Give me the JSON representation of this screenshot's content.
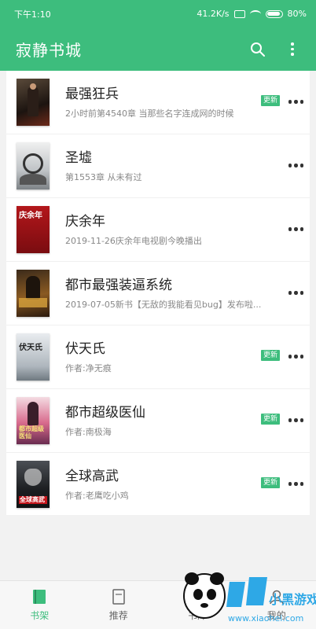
{
  "status": {
    "time": "下午1:10",
    "speed": "41.2K/s",
    "battery": "80%"
  },
  "app": {
    "title": "寂静书城"
  },
  "books": [
    {
      "title": "最强狂兵",
      "subtitle": "2小时前第4540章 当那些名字连成网的时候",
      "updated": true,
      "cover_text": ""
    },
    {
      "title": "圣墟",
      "subtitle": "第1553章 从未有过",
      "updated": false,
      "cover_text": ""
    },
    {
      "title": "庆余年",
      "subtitle": "2019-11-26庆余年电视剧今晚播出",
      "updated": false,
      "cover_text": "庆余年"
    },
    {
      "title": "都市最强装逼系统",
      "subtitle": "2019-07-05新书【无敌的我能看见bug】发布啦...",
      "updated": false,
      "cover_text": ""
    },
    {
      "title": "伏天氏",
      "subtitle": "作者:净无痕",
      "updated": true,
      "cover_text": "伏天氏"
    },
    {
      "title": "都市超级医仙",
      "subtitle": "作者:南极海",
      "updated": true,
      "cover_text": "都市超级医仙"
    },
    {
      "title": "全球高武",
      "subtitle": "作者:老鹰吃小鸡",
      "updated": true,
      "cover_text": "全球高武"
    }
  ],
  "badge_label": "更新",
  "nav": [
    {
      "label": "书架",
      "active": true
    },
    {
      "label": "推荐",
      "active": false
    },
    {
      "label": "书库",
      "active": false
    },
    {
      "label": "我的",
      "active": false
    }
  ],
  "watermark": {
    "text": "小黑游戏",
    "url": "www.xiaohei.com"
  },
  "colors": {
    "primary": "#3dbd7d",
    "badge": "#3dbd7d"
  }
}
